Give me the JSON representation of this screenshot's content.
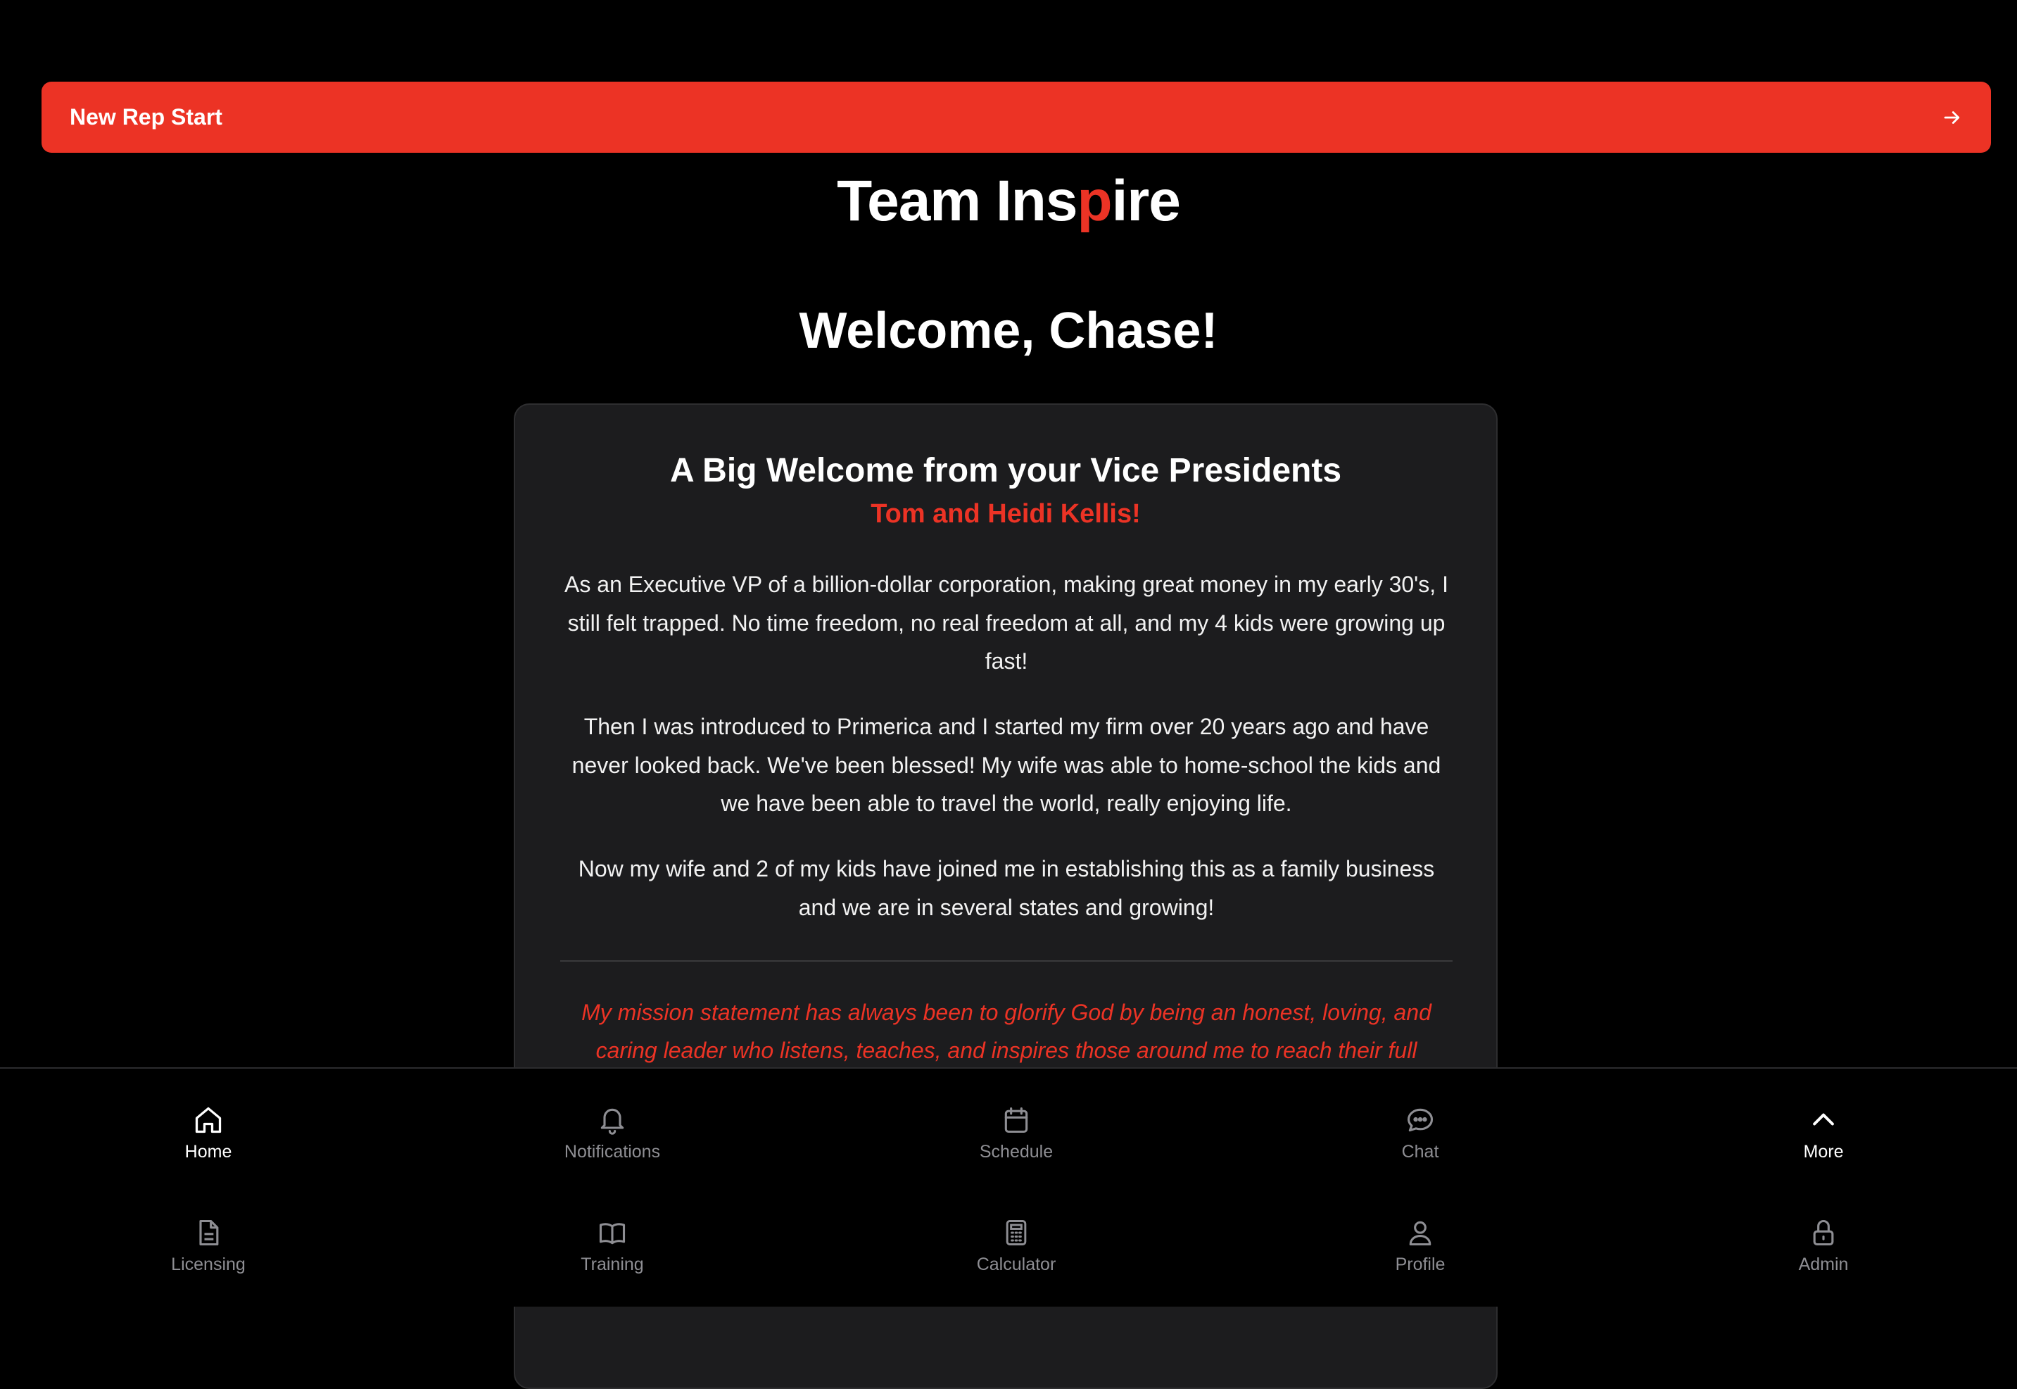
{
  "banner": {
    "label": "New Rep Start",
    "icon": "arrow-right-icon"
  },
  "brand": {
    "part1": "Team Ins",
    "accent": "p",
    "part2": "ire",
    "accent_color": "#ec3325"
  },
  "welcome": "Welcome, Chase!",
  "card": {
    "title": "A Big Welcome from your Vice Presidents",
    "subtitle": "Tom and Heidi Kellis!",
    "paragraphs": [
      "As an Executive VP of a billion-dollar corporation, making great money in my early 30's, I still felt trapped. No time freedom, no real freedom at all, and my 4 kids were growing up fast!",
      "Then I was introduced to Primerica and I started my firm over 20 years ago and have never looked back. We've been blessed! My wife was able to home-school the kids and we have been able to travel the world, really enjoying life.",
      "Now my wife and 2 of my kids have joined me in establishing this as a family business and we are in several states and growing!"
    ],
    "mission": "My mission statement has always been to glorify God by being an honest, loving, and caring leader who listens, teaches, and inspires those around me to reach their full"
  },
  "nav": {
    "items": [
      {
        "label": "Home",
        "icon": "home-icon",
        "active": true
      },
      {
        "label": "Notifications",
        "icon": "bell-icon"
      },
      {
        "label": "Schedule",
        "icon": "calendar-icon"
      },
      {
        "label": "Chat",
        "icon": "chat-icon"
      },
      {
        "label": "More",
        "icon": "chevron-up-icon",
        "active": true
      },
      {
        "label": "Licensing",
        "icon": "document-icon"
      },
      {
        "label": "Training",
        "icon": "book-icon"
      },
      {
        "label": "Calculator",
        "icon": "calculator-icon"
      },
      {
        "label": "Profile",
        "icon": "user-icon"
      },
      {
        "label": "Admin",
        "icon": "lock-icon"
      }
    ]
  },
  "colors": {
    "accent": "#ec3325",
    "background": "#000000",
    "card": "#1c1c1e",
    "muted": "#8e8e93"
  }
}
